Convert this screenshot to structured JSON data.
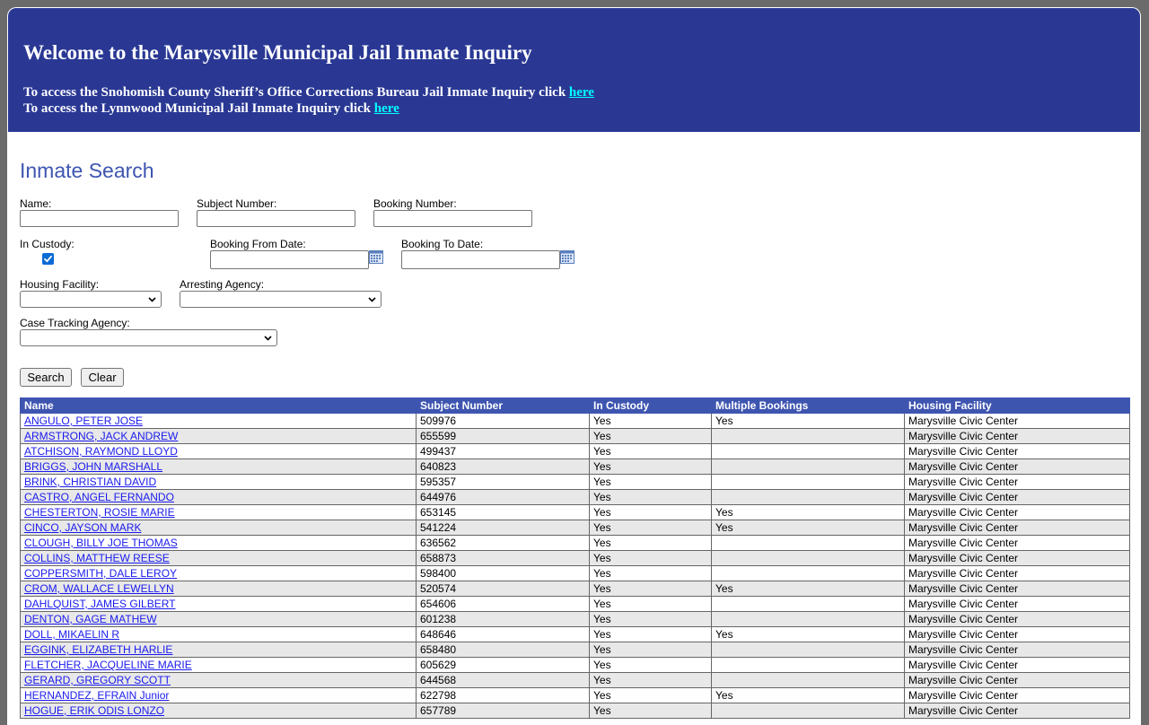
{
  "banner": {
    "title": "Welcome to the Marysville Municipal Jail Inmate Inquiry",
    "line1_text": "To access the Snohomish County Sheriff’s Office Corrections Bureau Jail Inmate Inquiry click ",
    "line1_link": "here",
    "line2_text": "To access the Lynnwood Municipal Jail Inmate Inquiry click ",
    "line2_link": "here"
  },
  "search": {
    "title": "Inmate Search",
    "name_label": "Name:",
    "name_value": "",
    "subject_label": "Subject Number:",
    "subject_value": "",
    "booking_label": "Booking Number:",
    "booking_value": "",
    "custody_label": "In Custody:",
    "custody_checked": true,
    "from_label": "Booking From Date:",
    "from_value": "",
    "to_label": "Booking To Date:",
    "to_value": "",
    "housing_label": "Housing Facility:",
    "housing_value": "",
    "agency_label": "Arresting Agency:",
    "agency_value": "",
    "tracking_label": "Case Tracking Agency:",
    "tracking_value": "",
    "search_button": "Search",
    "clear_button": "Clear"
  },
  "results": {
    "columns": [
      "Name",
      "Subject Number",
      "In Custody",
      "Multiple Bookings",
      "Housing Facility"
    ],
    "rows": [
      {
        "name": "ANGULO, PETER JOSE",
        "subject": "509976",
        "custody": "Yes",
        "multiple": "Yes",
        "facility": "Marysville Civic Center"
      },
      {
        "name": "ARMSTRONG, JACK ANDREW",
        "subject": "655599",
        "custody": "Yes",
        "multiple": "",
        "facility": "Marysville Civic Center"
      },
      {
        "name": "ATCHISON, RAYMOND LLOYD",
        "subject": "499437",
        "custody": "Yes",
        "multiple": "",
        "facility": "Marysville Civic Center"
      },
      {
        "name": "BRIGGS, JOHN MARSHALL",
        "subject": "640823",
        "custody": "Yes",
        "multiple": "",
        "facility": "Marysville Civic Center"
      },
      {
        "name": "BRINK, CHRISTIAN DAVID",
        "subject": "595357",
        "custody": "Yes",
        "multiple": "",
        "facility": "Marysville Civic Center"
      },
      {
        "name": "CASTRO, ANGEL FERNANDO",
        "subject": "644976",
        "custody": "Yes",
        "multiple": "",
        "facility": "Marysville Civic Center"
      },
      {
        "name": "CHESTERTON, ROSIE MARIE",
        "subject": "653145",
        "custody": "Yes",
        "multiple": "Yes",
        "facility": "Marysville Civic Center"
      },
      {
        "name": "CINCO, JAYSON MARK",
        "subject": "541224",
        "custody": "Yes",
        "multiple": "Yes",
        "facility": "Marysville Civic Center"
      },
      {
        "name": "CLOUGH, BILLY JOE THOMAS",
        "subject": "636562",
        "custody": "Yes",
        "multiple": "",
        "facility": "Marysville Civic Center"
      },
      {
        "name": "COLLINS, MATTHEW REESE",
        "subject": "658873",
        "custody": "Yes",
        "multiple": "",
        "facility": "Marysville Civic Center"
      },
      {
        "name": "COPPERSMITH, DALE LEROY",
        "subject": "598400",
        "custody": "Yes",
        "multiple": "",
        "facility": "Marysville Civic Center"
      },
      {
        "name": "CROM, WALLACE LEWELLYN",
        "subject": "520574",
        "custody": "Yes",
        "multiple": "Yes",
        "facility": "Marysville Civic Center"
      },
      {
        "name": "DAHLQUIST, JAMES GILBERT",
        "subject": "654606",
        "custody": "Yes",
        "multiple": "",
        "facility": "Marysville Civic Center"
      },
      {
        "name": "DENTON, GAGE MATHEW",
        "subject": "601238",
        "custody": "Yes",
        "multiple": "",
        "facility": "Marysville Civic Center"
      },
      {
        "name": "DOLL, MIKAELIN R",
        "subject": "648646",
        "custody": "Yes",
        "multiple": "Yes",
        "facility": "Marysville Civic Center"
      },
      {
        "name": "EGGINK, ELIZABETH HARLIE",
        "subject": "658480",
        "custody": "Yes",
        "multiple": "",
        "facility": "Marysville Civic Center"
      },
      {
        "name": "FLETCHER, JACQUELINE MARIE",
        "subject": "605629",
        "custody": "Yes",
        "multiple": "",
        "facility": "Marysville Civic Center"
      },
      {
        "name": "GERARD, GREGORY SCOTT",
        "subject": "644568",
        "custody": "Yes",
        "multiple": "",
        "facility": "Marysville Civic Center"
      },
      {
        "name": "HERNANDEZ, EFRAIN Junior",
        "subject": "622798",
        "custody": "Yes",
        "multiple": "Yes",
        "facility": "Marysville Civic Center"
      },
      {
        "name": "HOGUE, ERIK ODIS LONZO",
        "subject": "657789",
        "custody": "Yes",
        "multiple": "",
        "facility": "Marysville Civic Center"
      }
    ]
  },
  "colors": {
    "banner": "#2a3894",
    "header_row": "#3e55b0",
    "title": "#3e55b0",
    "link": "#1a1aee",
    "banner_link": "#00ffff",
    "checkbox": "#0b6bd6"
  },
  "icons": {
    "calendar": "calendar-icon",
    "dropdown": "chevron-down-icon",
    "checkbox": "checkmark-icon"
  }
}
